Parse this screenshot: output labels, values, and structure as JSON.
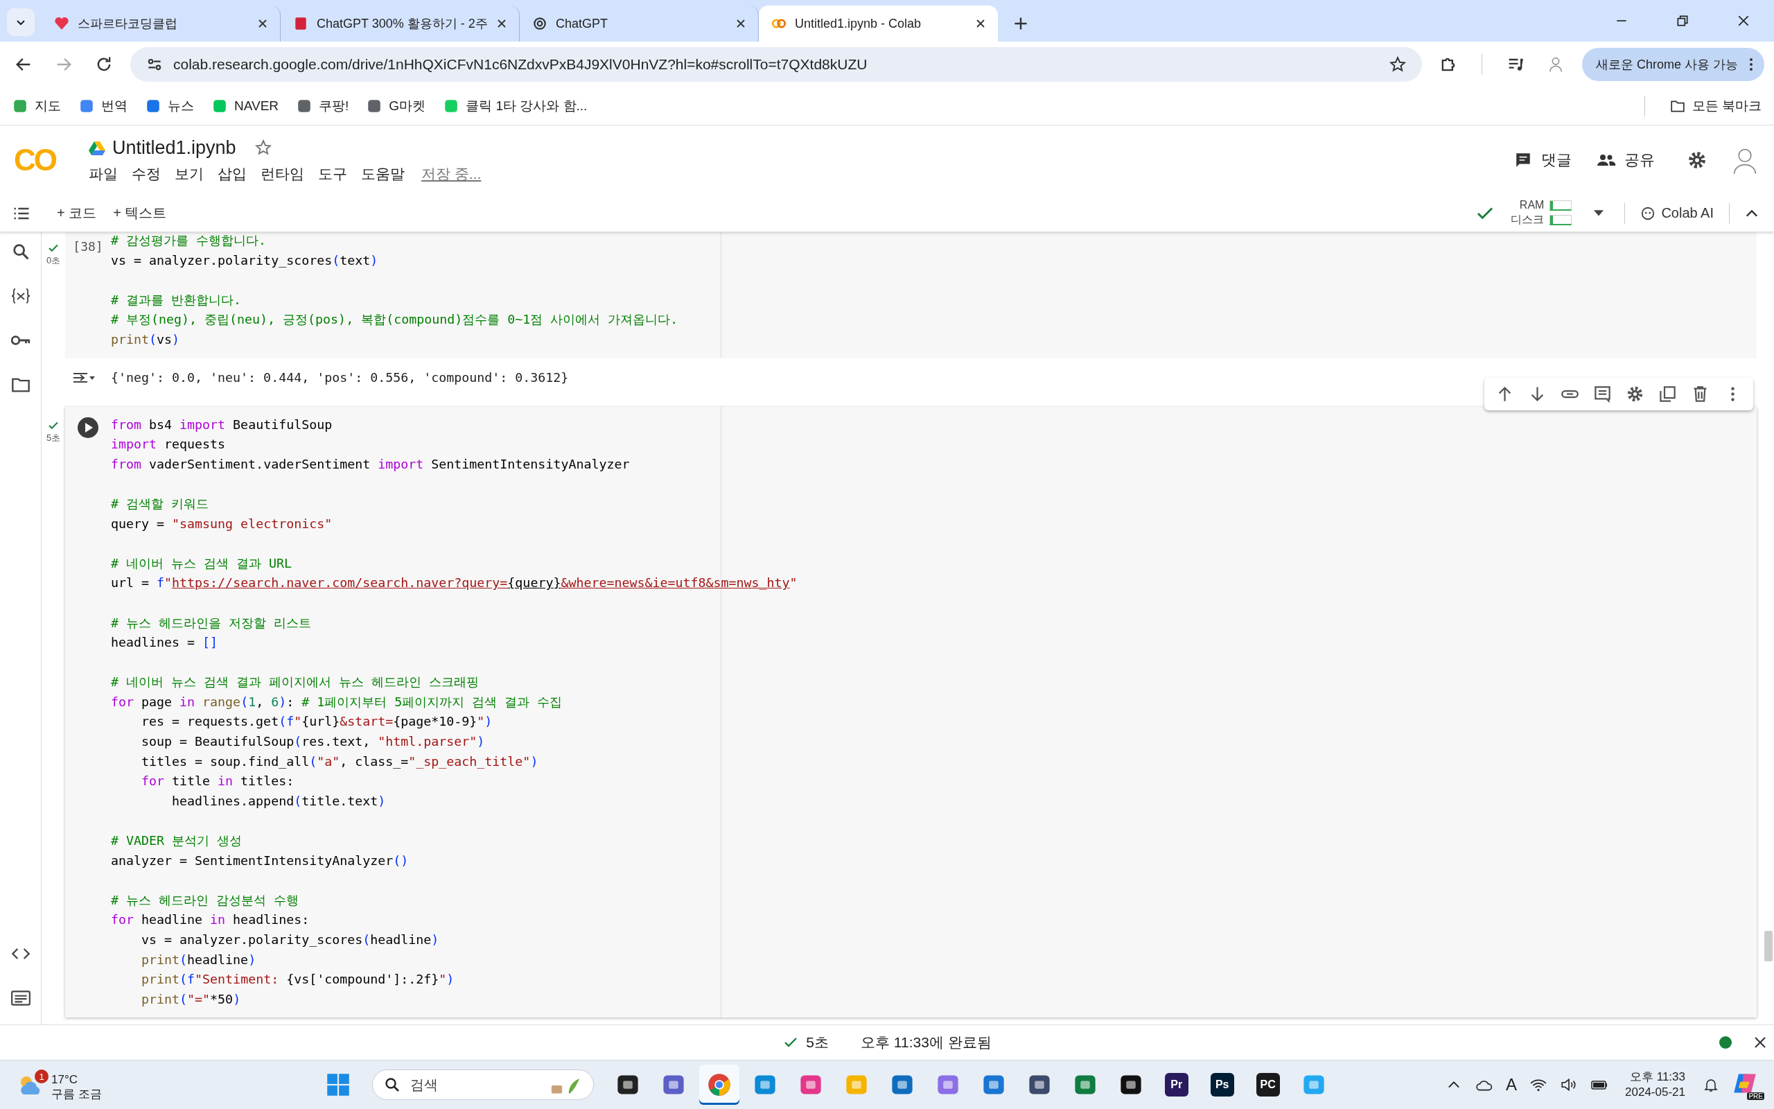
{
  "browser": {
    "tabs": [
      {
        "title": "스파르타코딩클럽",
        "kind": "code",
        "selected": false
      },
      {
        "title": "ChatGPT 300% 활용하기 - 2주",
        "kind": "book",
        "selected": false
      },
      {
        "title": "ChatGPT",
        "kind": "knot",
        "selected": false
      },
      {
        "title": "Untitled1.ipynb - Colab",
        "kind": "colab",
        "selected": true
      }
    ],
    "url": "colab.research.google.com/drive/1nHhQXiCFvN1c6NZdxvPxB4J9XlV0HnVZ?hl=ko#scrollTo=t7QXtd8kUZU",
    "update_button": "새로운 Chrome 사용 가능",
    "bookmarks": [
      {
        "label": "지도",
        "color": "#34a853"
      },
      {
        "label": "번역",
        "color": "#4285f4"
      },
      {
        "label": "뉴스",
        "color": "#1a73e8"
      },
      {
        "label": "NAVER",
        "color": "#03c75a"
      },
      {
        "label": "쿠팡!",
        "color": "#5f6368"
      },
      {
        "label": "G마켓",
        "color": "#5f6368"
      },
      {
        "label": "클릭 1타 강사와 함...",
        "color": "#19ce60"
      }
    ],
    "all_bookmarks": "모든 북마크"
  },
  "colab": {
    "logo": "CO",
    "title": "Untitled1.ipynb",
    "menu": [
      "파일",
      "수정",
      "보기",
      "삽입",
      "런타임",
      "도구",
      "도움말"
    ],
    "save_status": "저장 중...",
    "comment_button": "댓글",
    "share_button": "공유",
    "add_code": "+ 코드",
    "add_text": "+ 텍스트",
    "ram": {
      "label": "RAM",
      "level": 0.12
    },
    "disk": {
      "label": "디스크",
      "level": 0.12
    },
    "colab_ai": "Colab AI"
  },
  "cells": [
    {
      "exec_count": "[38]",
      "time": "0초",
      "done": true,
      "selected": false,
      "blocks": [
        [
          [
            {
              "kind": "cmt",
              "text": "# 감성평가를 수행합니다."
            }
          ],
          [
            {
              "kind": "plain",
              "text": "vs = analyzer.polarity_scores"
            },
            {
              "kind": "br",
              "text": "("
            },
            {
              "kind": "plain",
              "text": "text"
            },
            {
              "kind": "br",
              "text": ")"
            }
          ]
        ],
        [
          [
            {
              "kind": "cmt",
              "text": "# 결과를 반환합니다."
            }
          ],
          [
            {
              "kind": "cmt",
              "text": "# 부정(neg), 중립(neu), 긍정(pos), 복합(compound)점수를 0~1점 사이에서 가져옵니다."
            }
          ],
          [
            {
              "kind": "fn",
              "text": "print"
            },
            {
              "kind": "br",
              "text": "("
            },
            {
              "kind": "plain",
              "text": "vs"
            },
            {
              "kind": "br",
              "text": ")"
            }
          ]
        ]
      ],
      "output": "{'neg': 0.0, 'neu': 0.444, 'pos': 0.556, 'compound': 0.3612}"
    },
    {
      "time": "5초",
      "done": true,
      "selected": true,
      "blocks": [
        [
          [
            {
              "kind": "kw",
              "text": "from"
            },
            {
              "kind": "plain",
              "text": " bs4 "
            },
            {
              "kind": "kw",
              "text": "import"
            },
            {
              "kind": "plain",
              "text": " BeautifulSoup"
            }
          ],
          [
            {
              "kind": "kw",
              "text": "import"
            },
            {
              "kind": "plain",
              "text": " requests"
            }
          ],
          [
            {
              "kind": "kw",
              "text": "from"
            },
            {
              "kind": "plain",
              "text": " vaderSentiment.vaderSentiment "
            },
            {
              "kind": "kw",
              "text": "import"
            },
            {
              "kind": "plain",
              "text": " SentimentIntensityAnalyzer"
            }
          ]
        ],
        [
          [
            {
              "kind": "cmt",
              "text": "# 검색할 키워드"
            }
          ],
          [
            {
              "kind": "plain",
              "text": "query = "
            },
            {
              "kind": "str",
              "text": "\"samsung electronics\""
            }
          ]
        ],
        [
          [
            {
              "kind": "cmt",
              "text": "# 네이버 뉴스 검색 결과 URL"
            }
          ],
          [
            {
              "kind": "plain",
              "text": "url = "
            },
            {
              "kind": "br",
              "text": "f"
            },
            {
              "kind": "str",
              "text": "\""
            },
            {
              "kind": "link",
              "text": "https://search.naver.com/search.naver?query="
            },
            {
              "kind": "linkvar",
              "text": "{query}"
            },
            {
              "kind": "link",
              "text": "&where=news&ie=utf8&sm=nws_hty"
            },
            {
              "kind": "str",
              "text": "\""
            }
          ]
        ],
        [
          [
            {
              "kind": "cmt",
              "text": "# 뉴스 헤드라인을 저장할 리스트"
            }
          ],
          [
            {
              "kind": "plain",
              "text": "headlines = "
            },
            {
              "kind": "br",
              "text": "[]"
            }
          ]
        ],
        [
          [
            {
              "kind": "cmt",
              "text": "# 네이버 뉴스 검색 결과 페이지에서 뉴스 헤드라인 스크래핑"
            }
          ],
          [
            {
              "kind": "kw",
              "text": "for"
            },
            {
              "kind": "plain",
              "text": " page "
            },
            {
              "kind": "kw",
              "text": "in"
            },
            {
              "kind": "fn",
              "text": " range"
            },
            {
              "kind": "br",
              "text": "("
            },
            {
              "kind": "num",
              "text": "1"
            },
            {
              "kind": "plain",
              "text": ", "
            },
            {
              "kind": "num",
              "text": "6"
            },
            {
              "kind": "br",
              "text": ")"
            },
            {
              "kind": "plain",
              "text": ": "
            },
            {
              "kind": "cmt",
              "text": "# 1페이지부터 5페이지까지 검색 결과 수집"
            }
          ],
          [
            {
              "kind": "plain",
              "text": "    res = requests.get"
            },
            {
              "kind": "br",
              "text": "("
            },
            {
              "kind": "br",
              "text": "f"
            },
            {
              "kind": "str",
              "text": "\""
            },
            {
              "kind": "plain",
              "text": "{url}"
            },
            {
              "kind": "str",
              "text": "&start="
            },
            {
              "kind": "plain",
              "text": "{page*10-9}"
            },
            {
              "kind": "str",
              "text": "\""
            },
            {
              "kind": "br",
              "text": ")"
            }
          ],
          [
            {
              "kind": "plain",
              "text": "    soup = BeautifulSoup"
            },
            {
              "kind": "br",
              "text": "("
            },
            {
              "kind": "plain",
              "text": "res.text, "
            },
            {
              "kind": "str",
              "text": "\"html.parser\""
            },
            {
              "kind": "br",
              "text": ")"
            }
          ],
          [
            {
              "kind": "plain",
              "text": "    titles = soup.find_all"
            },
            {
              "kind": "br",
              "text": "("
            },
            {
              "kind": "str",
              "text": "\"a\""
            },
            {
              "kind": "plain",
              "text": ", class_="
            },
            {
              "kind": "str",
              "text": "\"_sp_each_title\""
            },
            {
              "kind": "br",
              "text": ")"
            }
          ],
          [
            {
              "kind": "kw",
              "text": "    for"
            },
            {
              "kind": "plain",
              "text": " title "
            },
            {
              "kind": "kw",
              "text": "in"
            },
            {
              "kind": "plain",
              "text": " titles:"
            }
          ],
          [
            {
              "kind": "plain",
              "text": "        headlines.append"
            },
            {
              "kind": "br",
              "text": "("
            },
            {
              "kind": "plain",
              "text": "title.text"
            },
            {
              "kind": "br",
              "text": ")"
            }
          ]
        ],
        [
          [
            {
              "kind": "cmt",
              "text": "# VADER 분석기 생성"
            }
          ],
          [
            {
              "kind": "plain",
              "text": "analyzer = SentimentIntensityAnalyzer"
            },
            {
              "kind": "br",
              "text": "()"
            }
          ]
        ],
        [
          [
            {
              "kind": "cmt",
              "text": "# 뉴스 헤드라인 감성분석 수행"
            }
          ],
          [
            {
              "kind": "kw",
              "text": "for"
            },
            {
              "kind": "plain",
              "text": " headline "
            },
            {
              "kind": "kw",
              "text": "in"
            },
            {
              "kind": "plain",
              "text": " headlines:"
            }
          ],
          [
            {
              "kind": "plain",
              "text": "    vs = analyzer.polarity_scores"
            },
            {
              "kind": "br",
              "text": "("
            },
            {
              "kind": "plain",
              "text": "headline"
            },
            {
              "kind": "br",
              "text": ")"
            }
          ],
          [
            {
              "kind": "fn",
              "text": "    print"
            },
            {
              "kind": "br",
              "text": "("
            },
            {
              "kind": "plain",
              "text": "headline"
            },
            {
              "kind": "br",
              "text": ")"
            }
          ],
          [
            {
              "kind": "fn",
              "text": "    print"
            },
            {
              "kind": "br",
              "text": "("
            },
            {
              "kind": "br",
              "text": "f"
            },
            {
              "kind": "str",
              "text": "\"Sentiment: "
            },
            {
              "kind": "plain",
              "text": "{vs['compound']:.2f}"
            },
            {
              "kind": "str",
              "text": "\""
            },
            {
              "kind": "br",
              "text": ")"
            }
          ],
          [
            {
              "kind": "fn",
              "text": "    print"
            },
            {
              "kind": "br",
              "text": "("
            },
            {
              "kind": "str",
              "text": "\"=\""
            },
            {
              "kind": "plain",
              "text": "*50"
            },
            {
              "kind": "br",
              "text": ")"
            }
          ]
        ]
      ]
    }
  ],
  "status_bar": {
    "time": "5초",
    "message": "오후 11:33에 완료됨"
  },
  "taskbar": {
    "weather": {
      "temp": "17°C",
      "desc": "구름 조금",
      "badge": "1"
    },
    "search_placeholder": "검색",
    "apps": [
      {
        "kind": "start",
        "selected": false
      },
      {
        "kind": "taskview",
        "selected": false
      },
      {
        "kind": "teams",
        "selected": false
      },
      {
        "kind": "chrome",
        "selected": true
      },
      {
        "kind": "edge",
        "selected": false
      },
      {
        "kind": "pink",
        "selected": false
      },
      {
        "kind": "folder",
        "selected": false
      },
      {
        "kind": "store",
        "selected": false
      },
      {
        "kind": "purple",
        "selected": false
      },
      {
        "kind": "circle",
        "selected": false
      },
      {
        "kind": "window",
        "selected": false
      },
      {
        "kind": "excel",
        "selected": false
      },
      {
        "kind": "acrobat",
        "selected": false
      },
      {
        "kind": "letter",
        "label": "Pr",
        "color": "#2a1a5e",
        "selected": false
      },
      {
        "kind": "letter",
        "label": "Ps",
        "color": "#001e36",
        "selected": false
      },
      {
        "kind": "letter",
        "label": "PC",
        "color": "#1a1a1a",
        "selected": false
      },
      {
        "kind": "vscode",
        "selected": false
      }
    ],
    "ime": "A",
    "clock": {
      "time": "오후 11:33",
      "date": "2024-05-21"
    },
    "copilot_badge": "PRE"
  }
}
